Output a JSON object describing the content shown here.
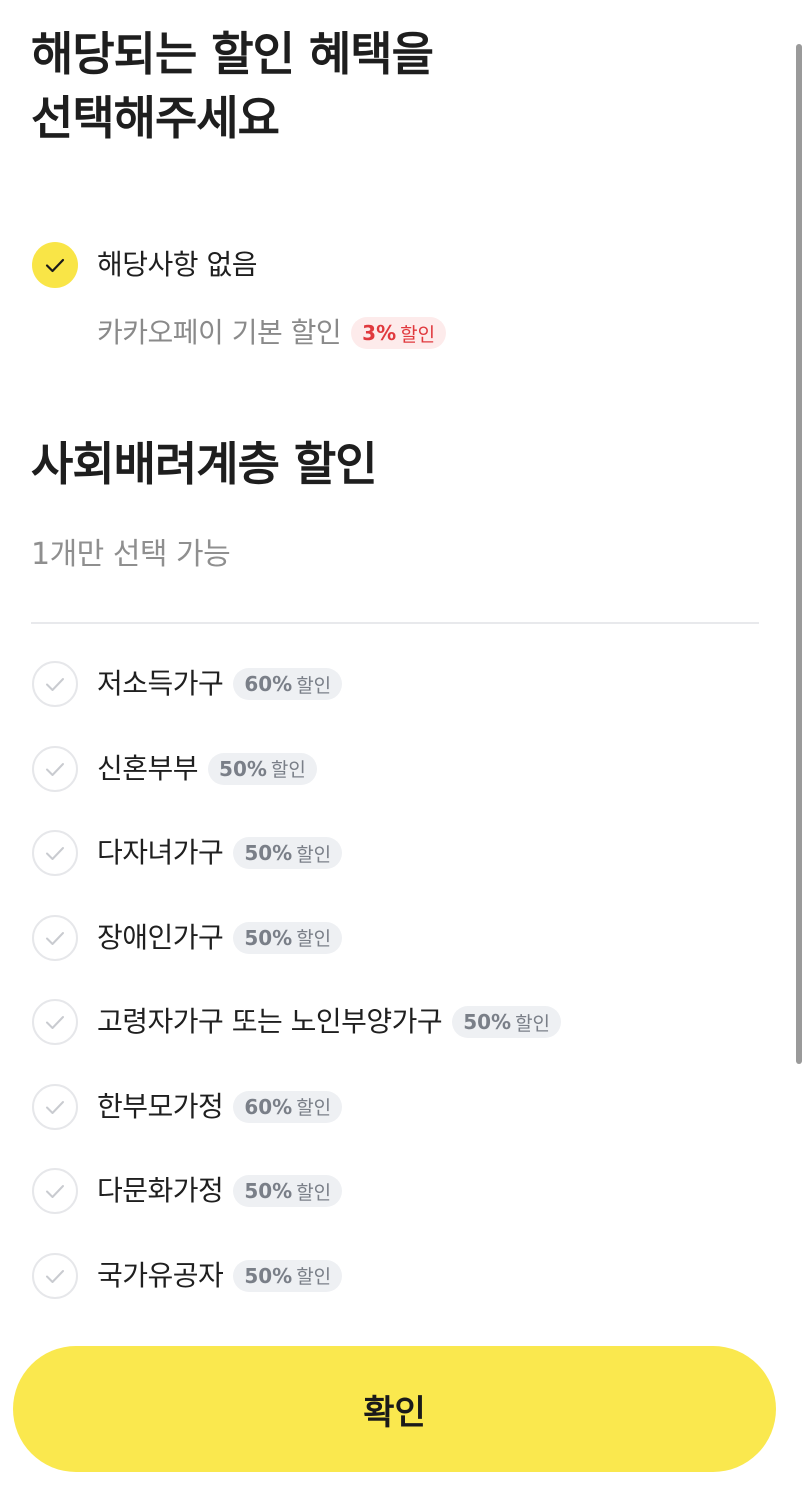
{
  "headline": {
    "line1": "해당되는 할인 혜택을",
    "line2": "선택해주세요"
  },
  "default_option": {
    "label": "해당사항 없음",
    "checked": true,
    "sub_label": "카카오페이 기본 할인",
    "badge_pct": "3%",
    "badge_word": "할인"
  },
  "section": {
    "title": "사회배려계층 할인",
    "subtitle": "1개만 선택 가능"
  },
  "options": [
    {
      "label": "저소득가구",
      "pct": "60%",
      "word": "할인",
      "checked": false
    },
    {
      "label": "신혼부부",
      "pct": "50%",
      "word": "할인",
      "checked": false
    },
    {
      "label": "다자녀가구",
      "pct": "50%",
      "word": "할인",
      "checked": false
    },
    {
      "label": "장애인가구",
      "pct": "50%",
      "word": "할인",
      "checked": false
    },
    {
      "label": "고령자가구 또는 노인부양가구",
      "pct": "50%",
      "word": "할인",
      "checked": false
    },
    {
      "label": "한부모가정",
      "pct": "60%",
      "word": "할인",
      "checked": false
    },
    {
      "label": "다문화가정",
      "pct": "50%",
      "word": "할인",
      "checked": false
    },
    {
      "label": "국가유공자",
      "pct": "50%",
      "word": "할인",
      "checked": false
    }
  ],
  "confirm_button": {
    "label": "확인"
  },
  "colors": {
    "accent_yellow": "#fae84e",
    "badge_red_text": "#e0393e",
    "badge_red_bg": "#fdebeb",
    "badge_gray_text": "#7a7f88",
    "badge_gray_bg": "#eef0f3"
  },
  "icons": {
    "check": "check-icon"
  }
}
